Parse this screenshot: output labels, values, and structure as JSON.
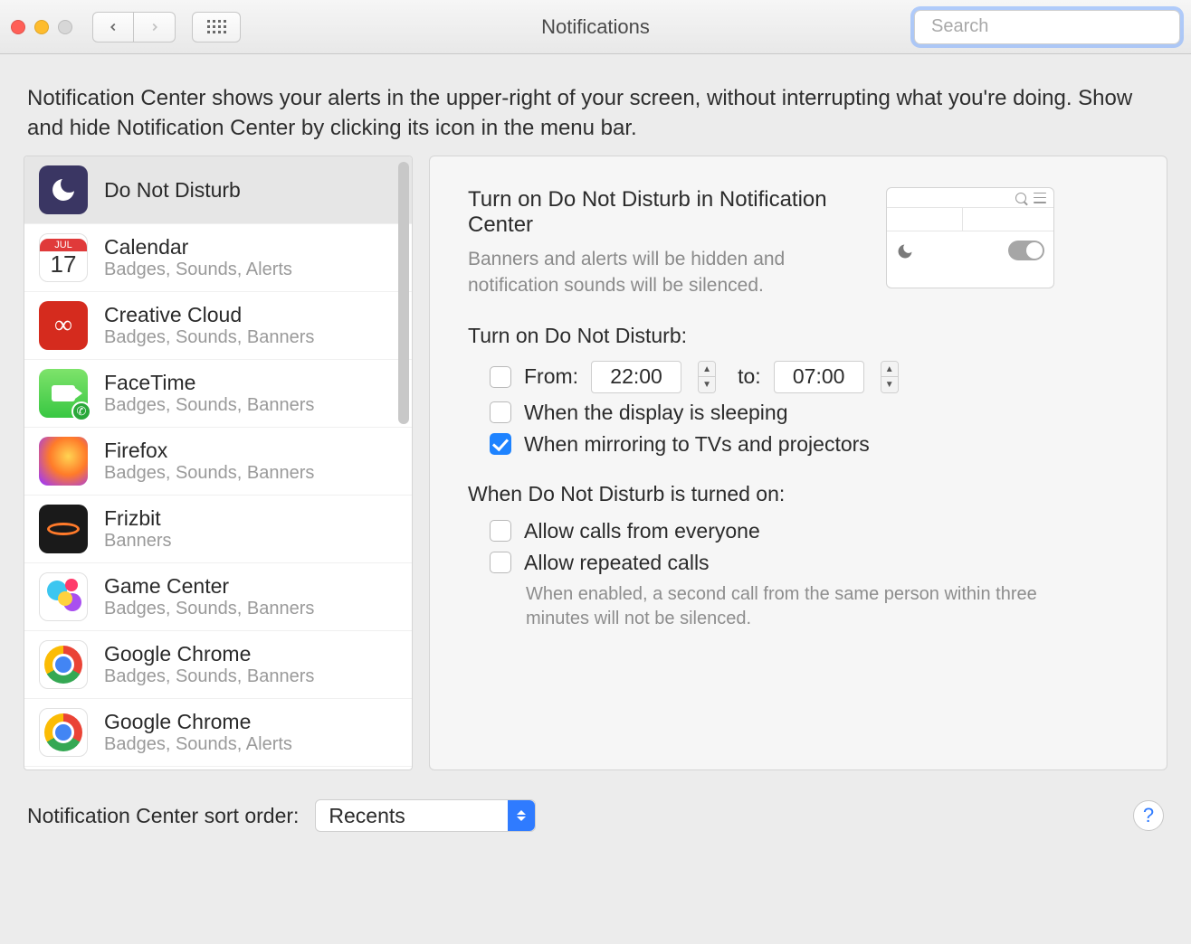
{
  "window": {
    "title": "Notifications",
    "search_placeholder": "Search"
  },
  "description": "Notification Center shows your alerts in the upper-right of your screen, without interrupting what you're doing. Show and hide Notification Center by clicking its icon in the menu bar.",
  "sidebar": {
    "items": [
      {
        "name": "Do Not Disturb",
        "sub": "",
        "iconClass": "ic-dnd",
        "selected": true
      },
      {
        "name": "Calendar",
        "sub": "Badges, Sounds, Alerts",
        "iconClass": "ic-cal"
      },
      {
        "name": "Creative Cloud",
        "sub": "Badges, Sounds, Banners",
        "iconClass": "ic-cc"
      },
      {
        "name": "FaceTime",
        "sub": "Badges, Sounds, Banners",
        "iconClass": "ic-ft"
      },
      {
        "name": "Firefox",
        "sub": "Badges, Sounds, Banners",
        "iconClass": "ic-ff"
      },
      {
        "name": "Frizbit",
        "sub": "Banners",
        "iconClass": "ic-fz"
      },
      {
        "name": "Game Center",
        "sub": "Badges, Sounds, Banners",
        "iconClass": "ic-gc"
      },
      {
        "name": "Google Chrome",
        "sub": "Badges, Sounds, Banners",
        "iconClass": "ic-ch"
      },
      {
        "name": "Google Chrome",
        "sub": "Badges, Sounds, Alerts",
        "iconClass": "ic-ch"
      }
    ]
  },
  "detail": {
    "head_title": "Turn on Do Not Disturb in Notification Center",
    "head_sub": "Banners and alerts will be hidden and notification sounds will be silenced.",
    "schedule_header": "Turn on Do Not Disturb:",
    "from_label": "From:",
    "from_time": "22:00",
    "to_label": "to:",
    "to_time": "07:00",
    "display_sleep_label": "When the display is sleeping",
    "mirroring_label": "When mirroring to TVs and projectors",
    "when_on_header": "When Do Not Disturb is turned on:",
    "allow_calls_label": "Allow calls from everyone",
    "allow_repeated_label": "Allow repeated calls",
    "repeated_hint": "When enabled, a second call from the same person within three minutes will not be silenced.",
    "checkboxes": {
      "from": false,
      "display_sleep": false,
      "mirroring": true,
      "allow_calls": false,
      "allow_repeated": false
    }
  },
  "footer": {
    "sort_label": "Notification Center sort order:",
    "sort_value": "Recents",
    "help_label": "?"
  },
  "calendar_icon": {
    "month": "JUL",
    "day": "17"
  },
  "cc_icon_text": "∞"
}
